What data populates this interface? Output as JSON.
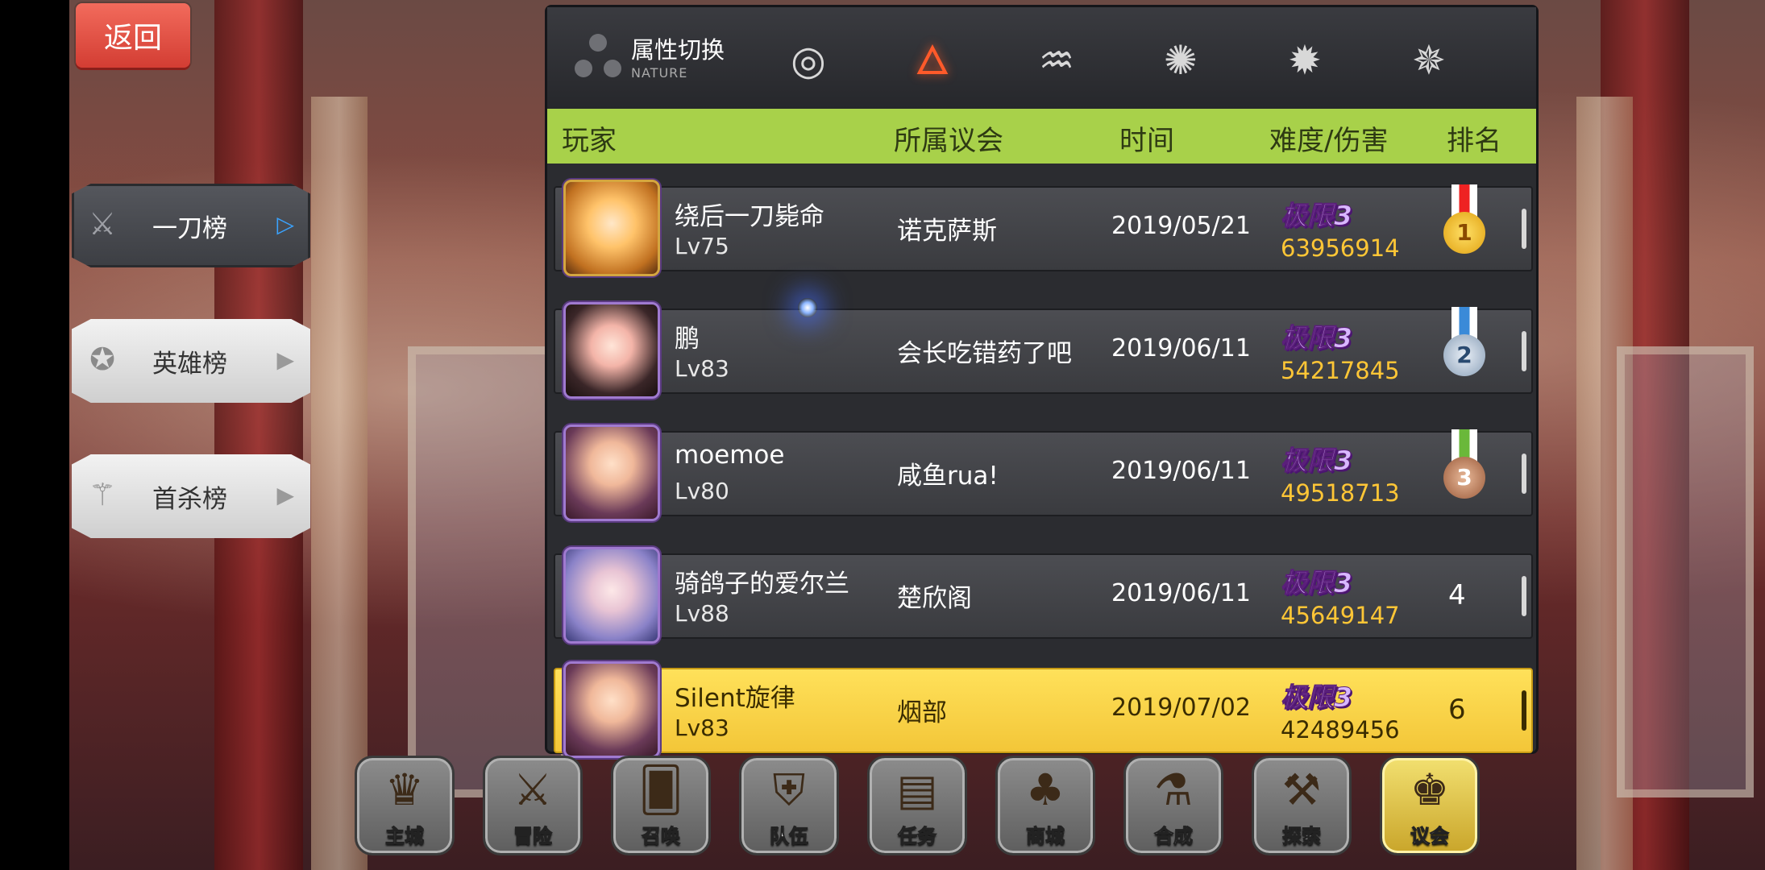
{
  "back_button": "返回",
  "side_tabs": [
    {
      "label": "一刀榜",
      "icon": "crossed-swords-heart-icon",
      "active": true
    },
    {
      "label": "英雄榜",
      "icon": "medal-icon",
      "active": false
    },
    {
      "label": "首杀榜",
      "icon": "blades-icon",
      "active": false
    }
  ],
  "nature": {
    "title": "属性切换",
    "subtitle": "NATURE",
    "elements": [
      {
        "icon": "ring-element-icon",
        "selected": false
      },
      {
        "icon": "fire-element-icon",
        "selected": true
      },
      {
        "icon": "water-element-icon",
        "selected": false
      },
      {
        "icon": "wind-element-icon",
        "selected": false
      },
      {
        "icon": "light-element-icon",
        "selected": false
      },
      {
        "icon": "dark-element-icon",
        "selected": false
      }
    ]
  },
  "table": {
    "headers": {
      "player": "玩家",
      "guild": "所属议会",
      "time": "时间",
      "difficulty": "难度/伤害",
      "rank": "排名"
    },
    "rows": [
      {
        "name": "绕后一刀毙命",
        "level": "Lv75",
        "guild": "诺克萨斯",
        "time": "2019/05/21",
        "difficulty": "极限3",
        "damage": "63956914",
        "rank": "1",
        "medal": "gold"
      },
      {
        "name": "鹏",
        "level": "Lv83",
        "guild": "会长吃错药了吧",
        "time": "2019/06/11",
        "difficulty": "极限3",
        "damage": "54217845",
        "rank": "2",
        "medal": "silver"
      },
      {
        "name": "moemoe",
        "level": "Lv80",
        "guild": "咸鱼rua!",
        "time": "2019/06/11",
        "difficulty": "极限3",
        "damage": "49518713",
        "rank": "3",
        "medal": "bronze"
      },
      {
        "name": "骑鸽子的爱尔兰",
        "level": "Lv88",
        "guild": "楚欣阁",
        "time": "2019/06/11",
        "difficulty": "极限3",
        "damage": "45649147",
        "rank": "4",
        "medal": ""
      },
      {
        "name": "Silent旋律",
        "level": "Lv83",
        "guild": "烟部",
        "time": "2019/07/02",
        "difficulty": "极限3",
        "damage": "42489456",
        "rank": "6",
        "medal": "",
        "is_self": true
      }
    ]
  },
  "nav": [
    {
      "label": "主城",
      "icon": "crown-icon"
    },
    {
      "label": "冒险",
      "icon": "crossed-axes-icon"
    },
    {
      "label": "召唤",
      "icon": "summon-card-icon"
    },
    {
      "label": "队伍",
      "icon": "winged-shield-icon"
    },
    {
      "label": "任务",
      "icon": "scroll-book-icon"
    },
    {
      "label": "商城",
      "icon": "shop-tree-icon"
    },
    {
      "label": "合成",
      "icon": "potion-icon"
    },
    {
      "label": "探索",
      "icon": "shovel-compass-icon"
    },
    {
      "label": "议会",
      "icon": "council-emblem-icon",
      "active": true
    }
  ],
  "colors": {
    "header_green": "#a8d14a",
    "self_row_yellow": "#f3c638",
    "damage_gold": "#ffc636",
    "back_red": "#d33d33",
    "active_arrow_blue": "#3aa3ff"
  }
}
